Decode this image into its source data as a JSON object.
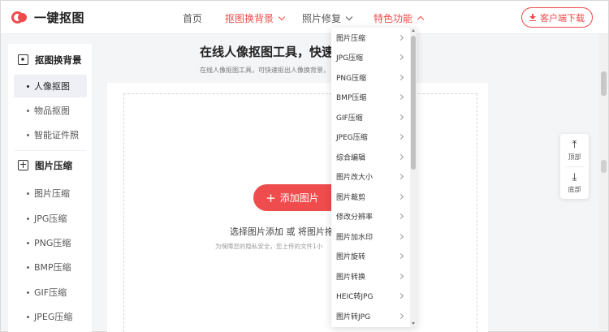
{
  "brand": {
    "name": "一键抠图"
  },
  "nav": {
    "home": "首页",
    "cutout": "抠图换背景",
    "photo_repair": "照片修复",
    "features": "特色功能",
    "download": "客户端下载"
  },
  "sidebar": {
    "group1": {
      "title": "抠图换背景",
      "items": [
        {
          "label": "人像抠图",
          "active": true
        },
        {
          "label": "物品抠图"
        },
        {
          "label": "智能证件照"
        }
      ]
    },
    "group2": {
      "title": "图片压缩",
      "items": [
        {
          "label": "图片压缩"
        },
        {
          "label": "JPG压缩"
        },
        {
          "label": "PNG压缩"
        },
        {
          "label": "BMP压缩"
        },
        {
          "label": "GIF压缩"
        },
        {
          "label": "JPEG压缩"
        }
      ]
    }
  },
  "main": {
    "title": "在线人像抠图工具，快速",
    "subtitle": "在线人像抠图工具，可快速抠出人像换背景，",
    "add_button": "添加图片",
    "hint": "选择图片添加 或 将图片拖",
    "privacy": "为保障您的隐私安全，您上传的文件1小"
  },
  "dropdown": {
    "items": [
      "图片压缩",
      "JPG压缩",
      "PNG压缩",
      "BMP压缩",
      "GIF压缩",
      "JPEG压缩",
      "综合编辑",
      "图片改大小",
      "图片裁剪",
      "修改分辨率",
      "图片加水印",
      "图片旋转",
      "图片转换",
      "HEIC转JPG",
      "图片转JPG"
    ]
  },
  "float_panel": {
    "top": "顶部",
    "bottom": "底部"
  },
  "colors": {
    "accent": "#ef4a4a"
  }
}
